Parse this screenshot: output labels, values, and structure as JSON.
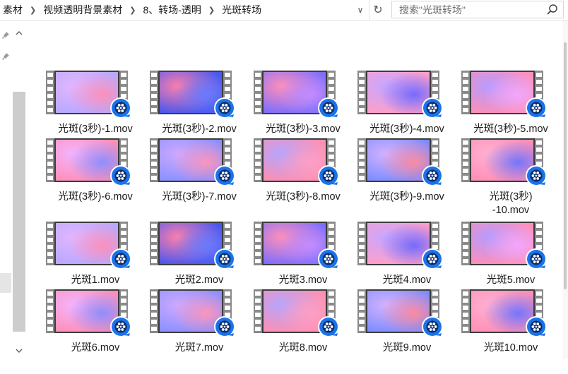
{
  "breadcrumbs": [
    "素材",
    "视频透明背景素材",
    "8、转场-透明",
    "光斑转场"
  ],
  "search": {
    "placeholder": "搜索\"光斑转场\""
  },
  "files": [
    {
      "name": "光斑(3秒)-1.mov",
      "c1": "#b6a8ff",
      "c2": "#ff8fb8",
      "c3": "#e3b6ff"
    },
    {
      "name": "光斑(3秒)-2.mov",
      "c1": "#4756ee",
      "c2": "#6b7cff",
      "c3": "#ff7faa"
    },
    {
      "name": "光斑(3秒)-3.mov",
      "c1": "#7a6dff",
      "c2": "#c48dff",
      "c3": "#ff8fb8"
    },
    {
      "name": "光斑(3秒)-4.mov",
      "c1": "#ff9fc8",
      "c2": "#6f68ff",
      "c3": "#c7a7ff"
    },
    {
      "name": "光斑(3秒)-5.mov",
      "c1": "#ff8fb6",
      "c2": "#f2a8ff",
      "c3": "#b59bff"
    },
    {
      "name": "光斑(3秒)-6.mov",
      "c1": "#ff8fb6",
      "c2": "#8a8dff",
      "c3": "#f3b4ff"
    },
    {
      "name": "光斑(3秒)-7.mov",
      "c1": "#8890ff",
      "c2": "#ff95b9",
      "c3": "#cda9ff"
    },
    {
      "name": "光斑(3秒)-8.mov",
      "c1": "#ff8fb0",
      "c2": "#ff9fc4",
      "c3": "#b3a6ff"
    },
    {
      "name": "光斑(3秒)-9.mov",
      "c1": "#7b8cff",
      "c2": "#ff8a9e",
      "c3": "#d3b2ff"
    },
    {
      "name": "光斑(3秒)\n-10.mov",
      "c1": "#ff8fb5",
      "c2": "#6d73ff",
      "c3": "#ffb0d2"
    },
    {
      "name": "光斑1.mov",
      "c1": "#b6a8ff",
      "c2": "#ff8fb8",
      "c3": "#e3b6ff"
    },
    {
      "name": "光斑2.mov",
      "c1": "#4756ee",
      "c2": "#6b7cff",
      "c3": "#ff7faa"
    },
    {
      "name": "光斑3.mov",
      "c1": "#7a6dff",
      "c2": "#c48dff",
      "c3": "#ff8fb8"
    },
    {
      "name": "光斑4.mov",
      "c1": "#ff9fc8",
      "c2": "#6f68ff",
      "c3": "#c7a7ff"
    },
    {
      "name": "光斑5.mov",
      "c1": "#ff8fb6",
      "c2": "#f2a8ff",
      "c3": "#b59bff"
    },
    {
      "name": "光斑6.mov",
      "c1": "#ff8fb6",
      "c2": "#8a8dff",
      "c3": "#f3b4ff"
    },
    {
      "name": "光斑7.mov",
      "c1": "#8890ff",
      "c2": "#ff95b9",
      "c3": "#cda9ff"
    },
    {
      "name": "光斑8.mov",
      "c1": "#ff8fb0",
      "c2": "#ff9fc4",
      "c3": "#b3a6ff"
    },
    {
      "name": "光斑9.mov",
      "c1": "#7b8cff",
      "c2": "#ff8a9e",
      "c3": "#d3b2ff"
    },
    {
      "name": "光斑10.mov",
      "c1": "#ff8fb5",
      "c2": "#6d73ff",
      "c3": "#ffb0d2"
    }
  ],
  "icons": {
    "file_type": "video-player-icon",
    "film": "film-strip-icon",
    "pin": "pin-icon",
    "refresh": "refresh-icon",
    "search": "search-icon",
    "dropdown": "chevron-down-icon",
    "separator": "chevron-right-icon"
  },
  "colors": {
    "accent": "#0063b1",
    "badge": "#1a73e8",
    "film": "#8a8a8a"
  }
}
